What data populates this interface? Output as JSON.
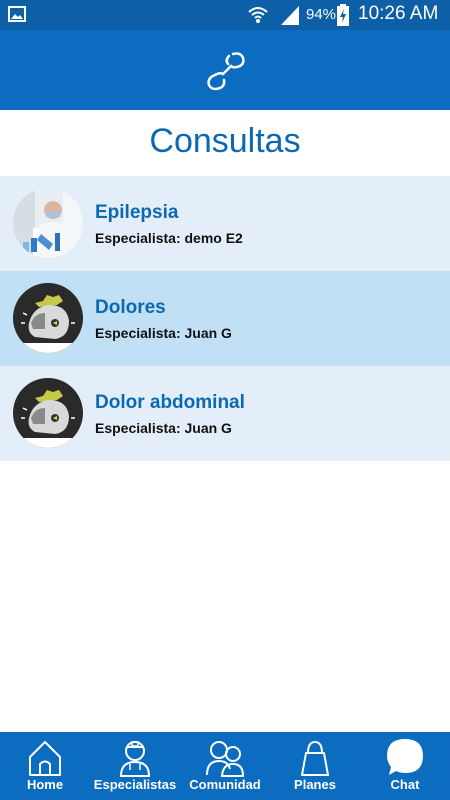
{
  "status_bar": {
    "battery_percent": "94%",
    "time": "10:26 AM"
  },
  "page": {
    "title": "Consultas"
  },
  "consultations": [
    {
      "title": "Epilepsia",
      "specialist": "Especialista: demo E2",
      "avatar": "doctor-photo"
    },
    {
      "title": "Dolores",
      "specialist": "Especialista: Juan G",
      "avatar": "helmet-logo"
    },
    {
      "title": "Dolor abdominal",
      "specialist": "Especialista: Juan G",
      "avatar": "helmet-logo"
    }
  ],
  "tabs": [
    {
      "label": "Home",
      "icon": "home-icon"
    },
    {
      "label": "Especialistas",
      "icon": "doctor-icon"
    },
    {
      "label": "Comunidad",
      "icon": "community-icon"
    },
    {
      "label": "Planes",
      "icon": "bag-icon"
    },
    {
      "label": "Chat",
      "icon": "chat-icon"
    }
  ],
  "colors": {
    "status_bar": "#0d5fa8",
    "app_bar": "#0c6cbf",
    "title_blue": "#0b69b4",
    "row_light": "#e4eef8",
    "row_active": "#c2e0f5"
  }
}
